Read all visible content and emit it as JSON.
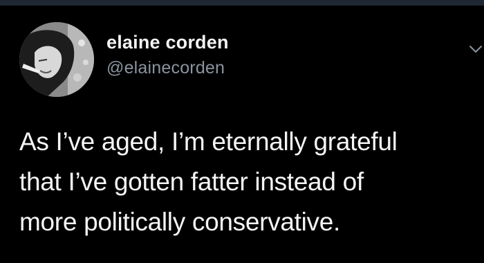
{
  "tweet": {
    "author": {
      "display_name": "elaine corden",
      "handle": "@elainecorden",
      "avatar_icon": "profile-photo"
    },
    "text_lines": [
      "As I’ve aged, I’m eternally grateful",
      "that I’ve gotten fatter instead of",
      "more politically conservative."
    ],
    "menu_icon": "chevron-down-icon"
  },
  "colors": {
    "background": "#000000",
    "top_strip": "#1f2733",
    "name": "#f2f2f2",
    "handle": "#8b949e",
    "text": "#f5f5f5"
  }
}
